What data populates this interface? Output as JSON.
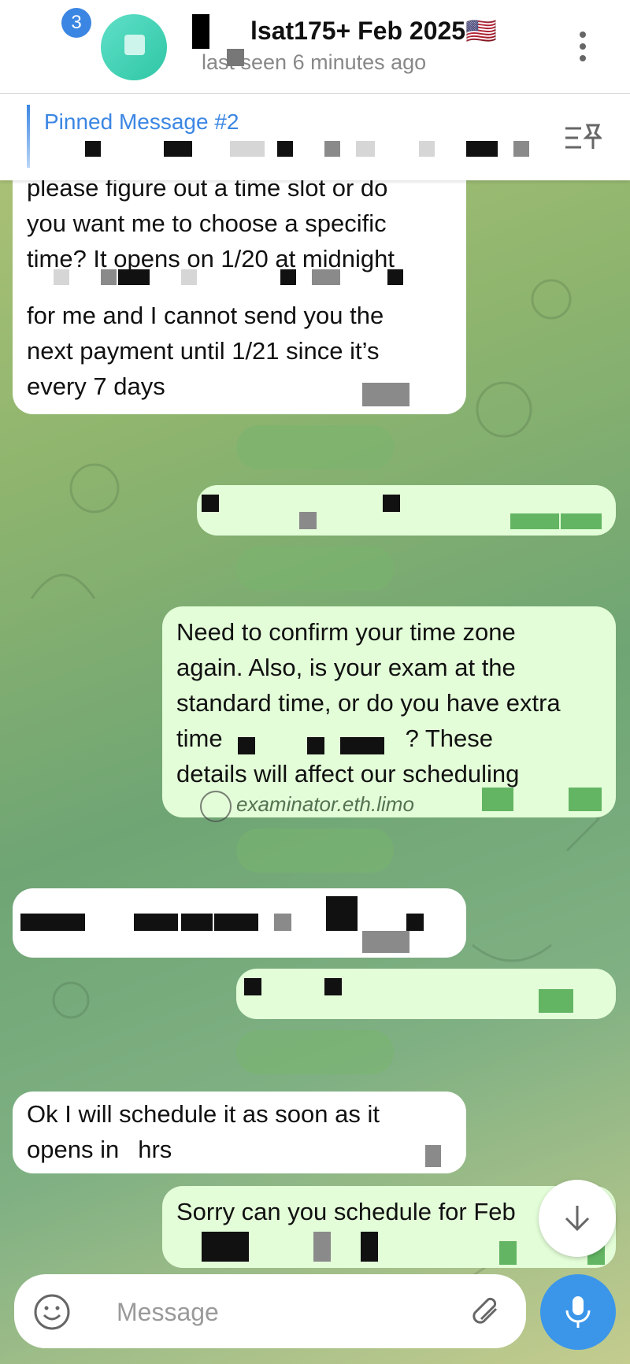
{
  "header": {
    "unread_count": "3",
    "chat_title": "lsat175+ Feb 2025🇺🇸",
    "status": "last seen 6 minutes ago"
  },
  "pinned": {
    "title": "Pinned Message #2"
  },
  "messages": [
    {
      "direction": "in",
      "lines": [
        "please figure out a time slot or do",
        "you want me to choose a specific",
        "time? It opens on 1/20 at midnight"
      ]
    },
    {
      "direction": "in",
      "lines": [
        "for me and I cannot send you the",
        "next payment until 1/21 since it’s",
        "every 7 days"
      ]
    },
    {
      "direction": "out",
      "lines": [
        "Need to confirm your time zone",
        "again. Also, is your exam at the",
        "standard time, or do you have extra",
        "time",
        "? These",
        "details will affect our scheduling"
      ]
    },
    {
      "direction": "in",
      "lines": [
        "Ok I will schedule it as soon as it",
        "opens in",
        "hrs"
      ]
    },
    {
      "direction": "out",
      "lines": [
        "Sorry can you schedule for Feb"
      ]
    }
  ],
  "watermark": "examinator.eth.limo",
  "composer": {
    "placeholder": "Message"
  },
  "colors": {
    "accent": "#3b86e3",
    "outgoing": "#e3fdd8",
    "incoming": "#ffffff"
  }
}
